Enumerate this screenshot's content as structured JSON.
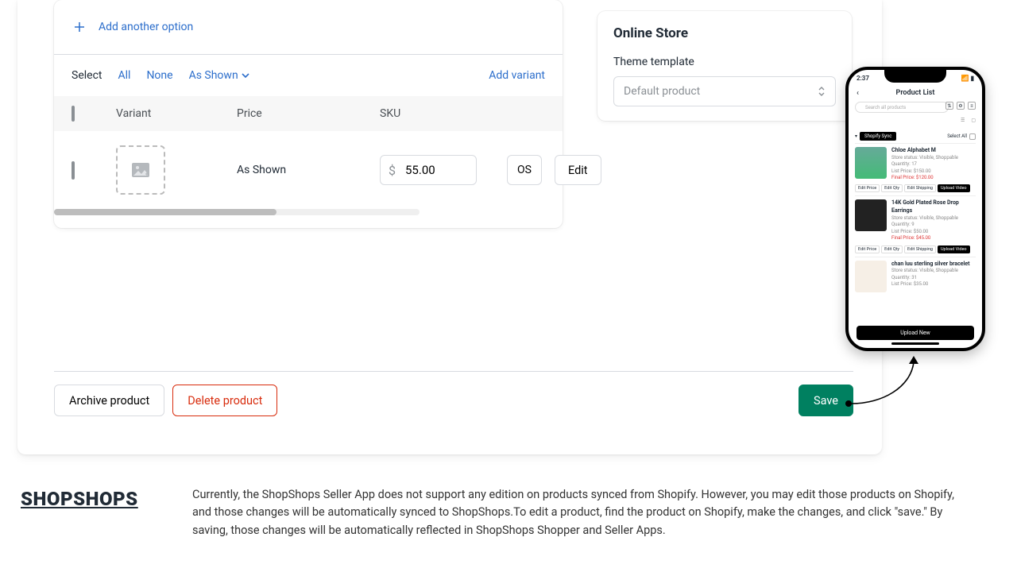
{
  "variants": {
    "add_option": "Add another option",
    "select_label": "Select",
    "all": "All",
    "none": "None",
    "as_shown": "As Shown",
    "add_variant": "Add variant",
    "headers": {
      "variant": "Variant",
      "price": "Price",
      "sku": "SKU"
    },
    "row": {
      "name": "As Shown",
      "currency": "$",
      "price": "55.00",
      "sku": "OS",
      "edit": "Edit"
    }
  },
  "store": {
    "title": "Online Store",
    "template_label": "Theme template",
    "template_value": "Default product"
  },
  "footer": {
    "archive": "Archive product",
    "delete": "Delete product",
    "save": "Save"
  },
  "phone": {
    "time": "2:37",
    "title": "Product List",
    "search_placeholder": "Search all products",
    "sync_badge": "Shopify Sync",
    "select_all": "Select All",
    "upload_new": "Upload New",
    "action_edit_price": "Edit Price",
    "action_edit_qty": "Edit Qty",
    "action_edit_shipping": "Edit Shipping",
    "action_upload_video": "Upload Video",
    "items": [
      {
        "name": "Chloe Alphabet M",
        "status": "Visible, Shoppable",
        "qty": "17",
        "list": "$150.00",
        "final": "$120.00"
      },
      {
        "name": "14K Gold Plated Rose Drop Earrings",
        "status": "Visible, Shoppable",
        "qty": "9",
        "list": "$50.00",
        "final": "$45.00"
      },
      {
        "name": "chan luu sterling silver bracelet",
        "status": "Visible, Shoppable",
        "qty": "31",
        "list": "$35.00",
        "final": ""
      }
    ]
  },
  "logo": "SHOPSHOPS",
  "explanation": "Currently, the ShopShops Seller App does not support any edition on products synced from Shopify. However, you may edit those products on Shopify, and those changes will be automatically synced to ShopShops.To edit a product, find the product on Shopify, make the changes, and click \"save.\" By saving, those changes will be automatically reflected in ShopShops Shopper and Seller Apps."
}
